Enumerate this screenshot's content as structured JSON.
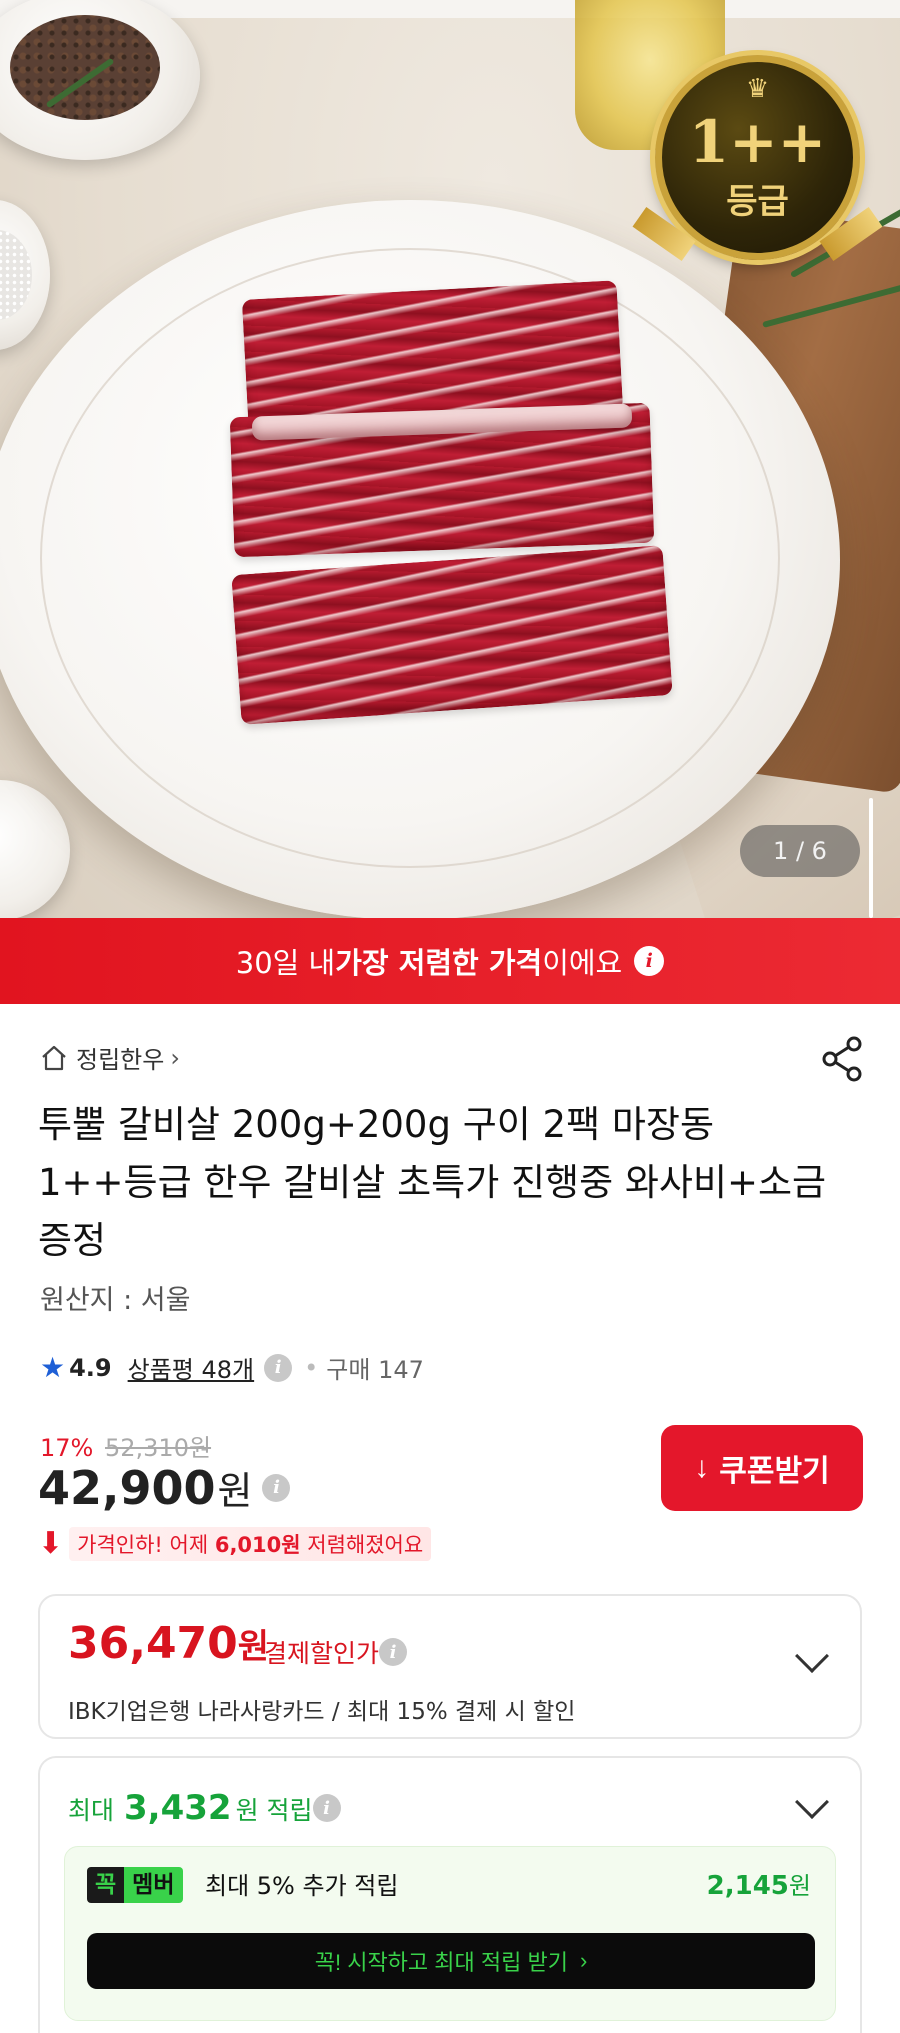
{
  "hero": {
    "badge_grade": "1++",
    "badge_label": "등급",
    "image_counter": "1 / 6"
  },
  "banner": {
    "prefix": "30일 내 ",
    "highlight": "가장 저렴한 가격",
    "suffix": "이에요"
  },
  "product": {
    "store_name": "정립한우",
    "title": "투뿔 갈비살 200g+200g 구이 2팩 마장동 1++등급 한우 갈비살 초특가 진행중 와사비+소금증정",
    "origin": "원산지 : 서울",
    "rating": "4.9",
    "reviews": "상품평 48개",
    "purchases": "구매 147"
  },
  "price": {
    "discount_pct": "17%",
    "original_price": "52,310원",
    "current_price": "42,900",
    "currency": "원",
    "coupon_button": "쿠폰받기",
    "price_drop_prefix": "가격인하! 어제 ",
    "price_drop_amount": "6,010원",
    "price_drop_suffix": " 저렴해졌어요"
  },
  "payment_discount": {
    "price": "36,470",
    "currency": "원",
    "label": "결제할인가",
    "description": "IBK기업은행 나라사랑카드 / 최대 15% 결제 시 할인"
  },
  "points": {
    "prefix": "최대",
    "amount": "3,432",
    "suffix": "원 적립",
    "member_badge_1": "꼭",
    "member_badge_2": "멤버",
    "member_text": "최대 5% 추가 적립",
    "member_amount": "2,145",
    "member_currency": "원",
    "member_button": "꼭! 시작하고 최대 적립 받기"
  },
  "colors": {
    "accent_red": "#e4172b",
    "point_green": "#16a33a",
    "member_green": "#39d24a",
    "star_blue": "#1e5fd6"
  }
}
